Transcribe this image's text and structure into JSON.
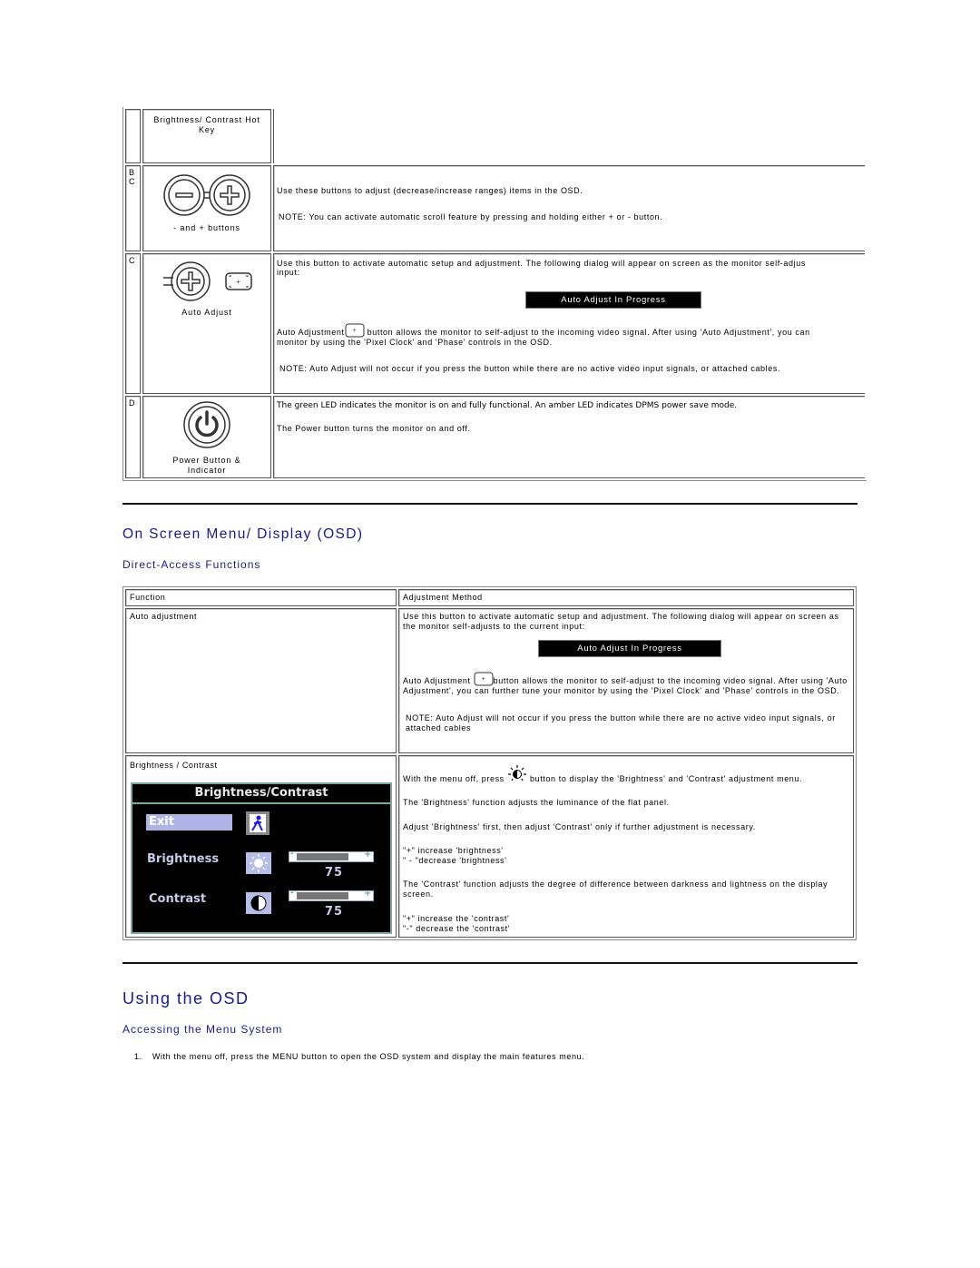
{
  "controls_table": {
    "rows": [
      {
        "letter": "",
        "caption": "Brightness/ Contrast Hot Key",
        "paragraphs": []
      },
      {
        "letter": "B C",
        "caption": "- and + buttons",
        "icon": "minus-plus-buttons-icon",
        "paragraphs": [
          "Use these buttons to adjust (decrease/increase ranges) items in the OSD.",
          "NOTE: You can activate automatic scroll feature by pressing and holding either + or - button."
        ]
      },
      {
        "letter": "C",
        "caption": "Auto Adjust",
        "icon": "auto-adjust-button-icon",
        "paragraphs": [
          "Use this button to activate automatic setup and adjustment. The following dialog will appear on screen as the monitor self-adjus",
          "input:"
        ],
        "dialog": "Auto Adjust In Progress",
        "after_dialog_prefix": "Auto Adjustment",
        "after_dialog_suffix": " button allows the monitor to self-adjust to the incoming video signal. After using 'Auto Adjustment', you can",
        "after_dialog_line2": "monitor by using the 'Pixel Clock' and 'Phase' controls in the OSD.",
        "note": "NOTE: Auto Adjust will not occur if you press the button while there are no active video input signals, or attached cables."
      },
      {
        "letter": "D",
        "caption": "Power Button & Indicator",
        "icon": "power-button-icon",
        "paragraphs": [
          "The green LED indicates the monitor is on and fully functional. An amber LED indicates DPMS power save mode.",
          "The Power button turns the monitor on and off."
        ]
      }
    ]
  },
  "osd_section": {
    "title": "On Screen Menu/ Display (OSD)",
    "subtitle": "Direct-Access Functions",
    "table": {
      "headers": [
        "Function",
        "Adjustment Method"
      ],
      "rows": [
        {
          "function": "Auto adjustment",
          "method_intro": "Use this button to activate automatic setup and adjustment. The following dialog will appear on screen as the monitor self-adjusts to the current input:",
          "dialog": "Auto Adjust In Progress",
          "method_prefix": "Auto Adjustment ",
          "method_body": "button allows the monitor to self-adjust to the incoming video signal. After using 'Auto Adjustment', you can further tune your monitor by using the 'Pixel Clock' and 'Phase' controls in the OSD.",
          "note": "NOTE: Auto Adjust will not occur if you press the button while there are no active video input signals, or attached cables"
        },
        {
          "function": "Brightness /  Contrast",
          "osd_menu": {
            "title": "Brightness/Contrast",
            "exit_label": "Exit",
            "items": [
              {
                "label": "Brightness",
                "icon": "sun-icon",
                "value": "75",
                "level_percent": 75
              },
              {
                "label": "Contrast",
                "icon": "contrast-icon",
                "value": "75",
                "level_percent": 75
              }
            ]
          },
          "method_prefix": "With the menu off, press ",
          "method_suffix": " button to display the 'Brightness' and 'Contrast' adjustment menu.",
          "lines": [
            "The 'Brightness' function adjusts the luminance of the flat panel.",
            "Adjust 'Brightness' first, then adjust 'Contrast' only if further adjustment is necessary."
          ],
          "brightness_keys": [
            "\"+\" increase 'brightness'",
            "\" - \"decrease 'brightness'"
          ],
          "contrast_desc": "The 'Contrast' function adjusts the degree of difference between darkness and lightness on the display screen.",
          "contrast_keys": [
            "\"+\" increase the 'contrast'",
            "\"-\" decrease the 'contrast'"
          ]
        }
      ]
    }
  },
  "using_section": {
    "title": "Using the OSD",
    "subtitle": "Accessing the Menu System",
    "steps": [
      {
        "number": "1.",
        "text": "With the menu off, press the MENU button to open the OSD system and display the main features menu."
      }
    ]
  },
  "colors": {
    "heading_blue": "#1a1a8c",
    "osd_exit_bg": "#aeb5e6"
  }
}
